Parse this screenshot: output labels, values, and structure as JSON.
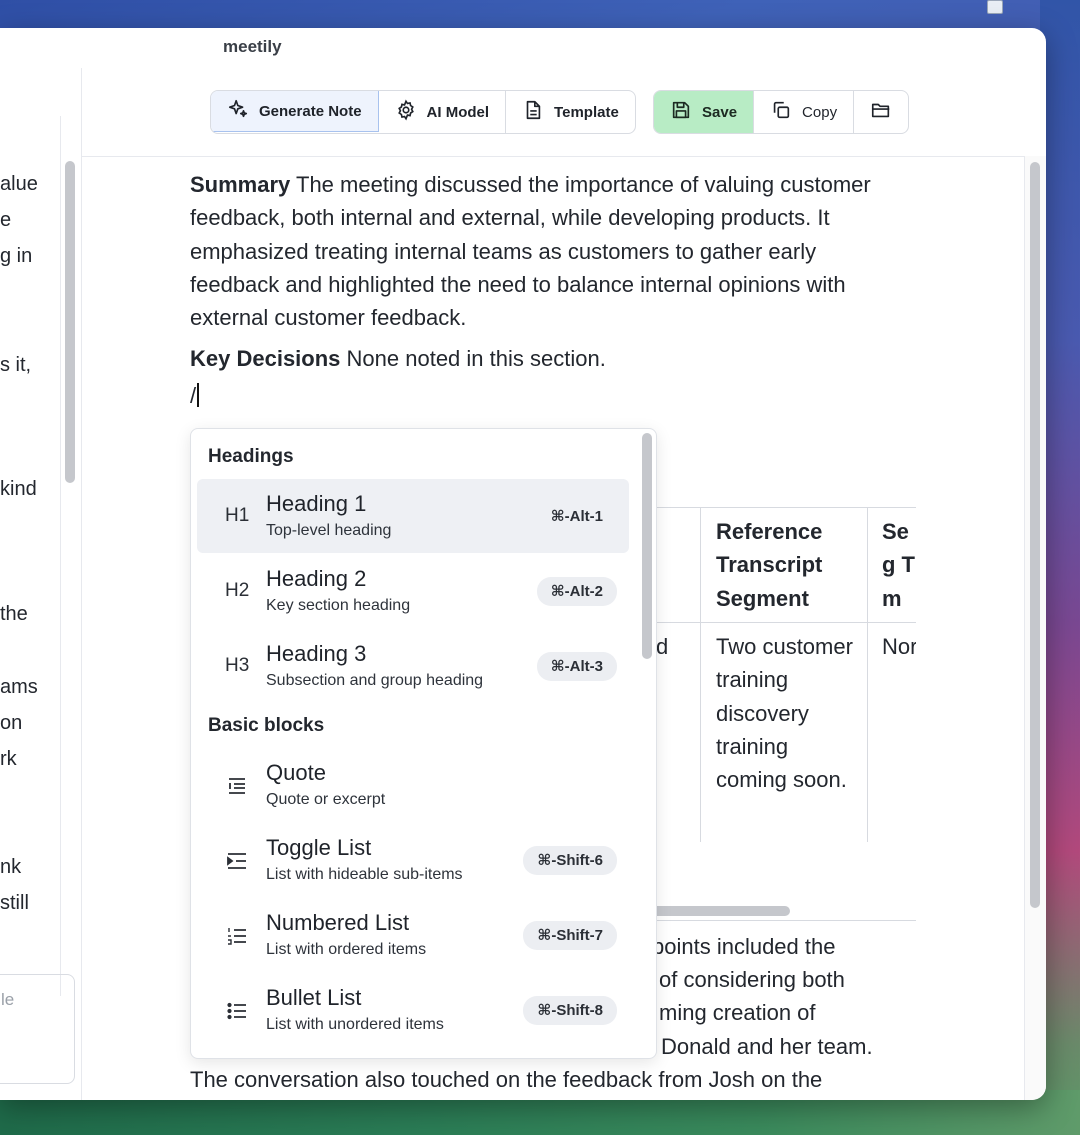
{
  "window": {
    "title": "meetily"
  },
  "toolbar": {
    "generate_note": "Generate Note",
    "ai_model": "AI Model",
    "template": "Template",
    "save": "Save",
    "copy": "Copy"
  },
  "left_fragments": [
    "alue",
    "e",
    "g in",
    "s it,",
    "kind",
    "the",
    "ams",
    "on",
    "rk",
    "nk",
    "still"
  ],
  "left_input_placeholder": "le",
  "document": {
    "summary_label": "Summary",
    "summary_text": "The meeting discussed the importance of valuing customer feedback, both internal and external, while developing products. It emphasized treating internal teams as customers to gather early feedback and highlighted the need to balance internal opinions with external customer feedback.",
    "decisions_label": "Key Decisions",
    "decisions_text": "None noted in this section.",
    "slash_input": "/"
  },
  "table": {
    "headers": [
      "Reference Transcript Segment",
      "Seg Tim"
    ],
    "cells": [
      "d",
      "Two customer training discovery training coming soon.",
      "Nor"
    ]
  },
  "below_table": [
    "points included the",
    "of considering both",
    "ming creation of",
    "Donald and her team.",
    "The conversation also touched on the feedback from Josh on the"
  ],
  "slash_menu": {
    "groups": [
      {
        "label": "Headings",
        "items": [
          {
            "icon": "H1",
            "title": "Heading 1",
            "subtitle": "Top-level heading",
            "shortcut": "⌘-Alt-1",
            "active": true
          },
          {
            "icon": "H2",
            "title": "Heading 2",
            "subtitle": "Key section heading",
            "shortcut": "⌘-Alt-2"
          },
          {
            "icon": "H3",
            "title": "Heading 3",
            "subtitle": "Subsection and group heading",
            "shortcut": "⌘-Alt-3"
          }
        ]
      },
      {
        "label": "Basic blocks",
        "items": [
          {
            "icon": "quote-icon",
            "title": "Quote",
            "subtitle": "Quote or excerpt",
            "shortcut": ""
          },
          {
            "icon": "toggle-list-icon",
            "title": "Toggle List",
            "subtitle": "List with hideable sub-items",
            "shortcut": "⌘-Shift-6"
          },
          {
            "icon": "numbered-list-icon",
            "title": "Numbered List",
            "subtitle": "List with ordered items",
            "shortcut": "⌘-Shift-7"
          },
          {
            "icon": "bullet-list-icon",
            "title": "Bullet List",
            "subtitle": "List with unordered items",
            "shortcut": "⌘-Shift-8"
          }
        ]
      }
    ]
  },
  "colors": {
    "accent_primary": "#eef3fd",
    "save_green": "#b8ecc5",
    "menu_active": "#eef0f4"
  }
}
